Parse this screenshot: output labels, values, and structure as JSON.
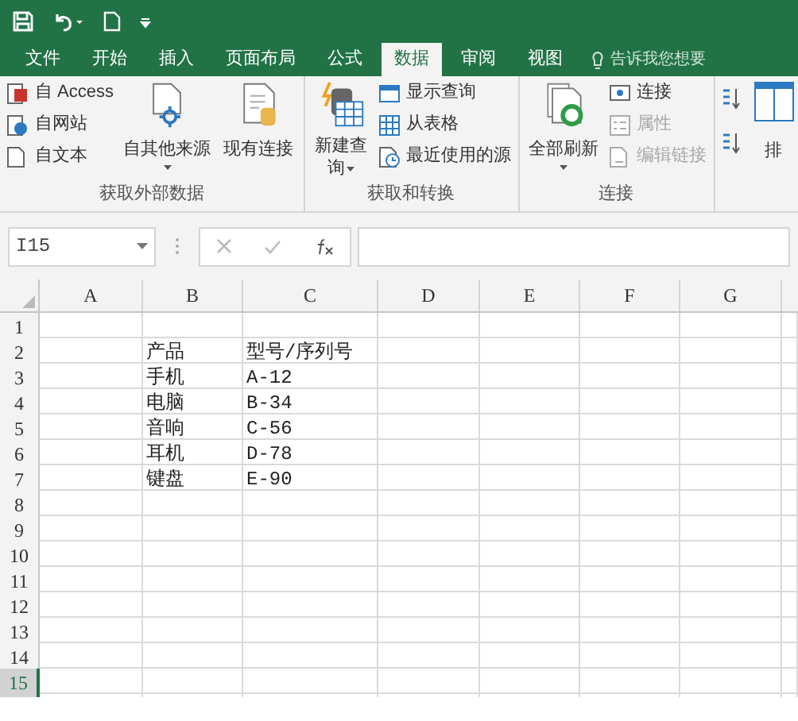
{
  "tabs": [
    {
      "label": "文件",
      "selected": false
    },
    {
      "label": "开始",
      "selected": false
    },
    {
      "label": "插入",
      "selected": false
    },
    {
      "label": "页面布局",
      "selected": false
    },
    {
      "label": "公式",
      "selected": false
    },
    {
      "label": "数据",
      "selected": true
    },
    {
      "label": "审阅",
      "selected": false
    },
    {
      "label": "视图",
      "selected": false
    }
  ],
  "tell_me": {
    "placeholder": "告诉我您想要"
  },
  "ribbon": {
    "groups": [
      {
        "label": "获取外部数据",
        "items": [
          {
            "kind": "small",
            "label": "自 Access",
            "disabled": false
          },
          {
            "kind": "small",
            "label": "自网站",
            "disabled": false
          },
          {
            "kind": "small",
            "label": "自文本",
            "disabled": false
          },
          {
            "kind": "large",
            "label": "自其他来源",
            "dropdown": true
          },
          {
            "kind": "large",
            "label": "现有连接",
            "dropdown": false
          }
        ]
      },
      {
        "label": "获取和转换",
        "items": [
          {
            "kind": "large",
            "label": "新建查询",
            "dropdown": true
          },
          {
            "kind": "small",
            "label": "显示查询",
            "disabled": false
          },
          {
            "kind": "small",
            "label": "从表格",
            "disabled": false
          },
          {
            "kind": "small",
            "label": "最近使用的源",
            "disabled": false
          }
        ]
      },
      {
        "label": "连接",
        "items": [
          {
            "kind": "large",
            "label": "全部刷新",
            "dropdown": true
          },
          {
            "kind": "small",
            "label": "连接",
            "disabled": false
          },
          {
            "kind": "small",
            "label": "属性",
            "disabled": true
          },
          {
            "kind": "small",
            "label": "编辑链接",
            "disabled": true
          }
        ]
      },
      {
        "items": [
          {
            "kind": "sort",
            "label": "排"
          }
        ]
      }
    ]
  },
  "name_box": {
    "value": "I15"
  },
  "columns": [
    "A",
    "B",
    "C",
    "D",
    "E",
    "F",
    "G"
  ],
  "rows": [
    {
      "number": "1",
      "selected": false
    },
    {
      "number": "2",
      "selected": false,
      "column_b": "产品",
      "column_c": "型号/序列号"
    },
    {
      "number": "3",
      "selected": false,
      "column_b": "手机",
      "column_c": "A-12"
    },
    {
      "number": "4",
      "selected": false,
      "column_b": "电脑",
      "column_c": "B-34"
    },
    {
      "number": "5",
      "selected": false,
      "column_b": "音响",
      "column_c": "C-56"
    },
    {
      "number": "6",
      "selected": false,
      "column_b": "耳机",
      "column_c": "D-78"
    },
    {
      "number": "7",
      "selected": false,
      "column_b": "键盘",
      "column_c": "E-90"
    },
    {
      "number": "8",
      "selected": false
    },
    {
      "number": "9",
      "selected": false
    },
    {
      "number": "10",
      "selected": false
    },
    {
      "number": "11",
      "selected": false
    },
    {
      "number": "12",
      "selected": false
    },
    {
      "number": "13",
      "selected": false
    },
    {
      "number": "14",
      "selected": false
    },
    {
      "number": "15",
      "selected": true
    }
  ]
}
